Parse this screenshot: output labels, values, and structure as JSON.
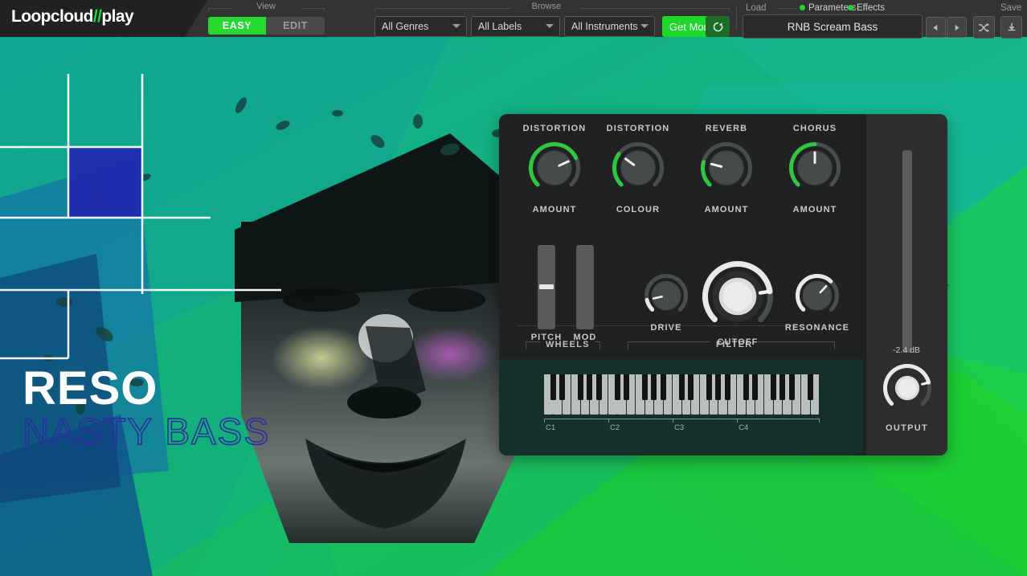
{
  "app": {
    "brand": "Loopcloud",
    "slash": "//",
    "product": "play"
  },
  "toolbar": {
    "view_label": "View",
    "view_easy": "EASY",
    "view_edit": "EDIT",
    "browse_label": "Browse",
    "genres": "All Genres",
    "labels": "All Labels",
    "instruments": "All Instruments",
    "get_more": "Get More",
    "refresh_icon": "refresh-icon",
    "load_label": "Load",
    "parameters_label": "Parameters",
    "effects_label": "Effects",
    "save_label": "Save",
    "preset_name": "RNB Scream Bass",
    "prev_icon": "prev-icon",
    "next_icon": "next-icon",
    "shuffle_icon": "shuffle-icon",
    "download_icon": "download-icon"
  },
  "artwork": {
    "title": "RESO",
    "subtitle": "NASTY BASS"
  },
  "colors": {
    "accent_green": "#1fd82c",
    "panel_bg": "#1f2122",
    "knob_green": "#2fc640",
    "knob_white": "#e8e8e8",
    "title_outline": "#2b2f9e"
  },
  "synth": {
    "effects": [
      {
        "name": "DISTORTION",
        "param": "AMOUNT",
        "value": 0.74,
        "arc": "green"
      },
      {
        "name": "DISTORTION",
        "param": "COLOUR",
        "value": 0.3,
        "arc": "green"
      },
      {
        "name": "REVERB",
        "param": "AMOUNT",
        "value": 0.22,
        "arc": "green"
      },
      {
        "name": "CHORUS",
        "param": "AMOUNT",
        "value": 0.5,
        "arc": "green"
      }
    ],
    "wheels_label": "WHEELS",
    "wheels": [
      {
        "name": "PITCH",
        "value": 0.5
      },
      {
        "name": "MOD",
        "value": 0.0
      }
    ],
    "filter_label": "FILTER",
    "filter": [
      {
        "name": "DRIVE",
        "value": 0.12,
        "arc": "white"
      },
      {
        "name": "CUTOFF",
        "value": 0.8,
        "arc": "white"
      },
      {
        "name": "RESONANCE",
        "value": 0.66,
        "arc": "white"
      }
    ],
    "keyboard": {
      "octave_labels": [
        "C1",
        "C2",
        "C3",
        "C4"
      ],
      "white_keys": 30,
      "first_note": "C1"
    },
    "output": {
      "level_db": "-2.4 dB",
      "name": "OUTPUT",
      "knob_value": 0.78,
      "meter_value": 0.0
    }
  }
}
